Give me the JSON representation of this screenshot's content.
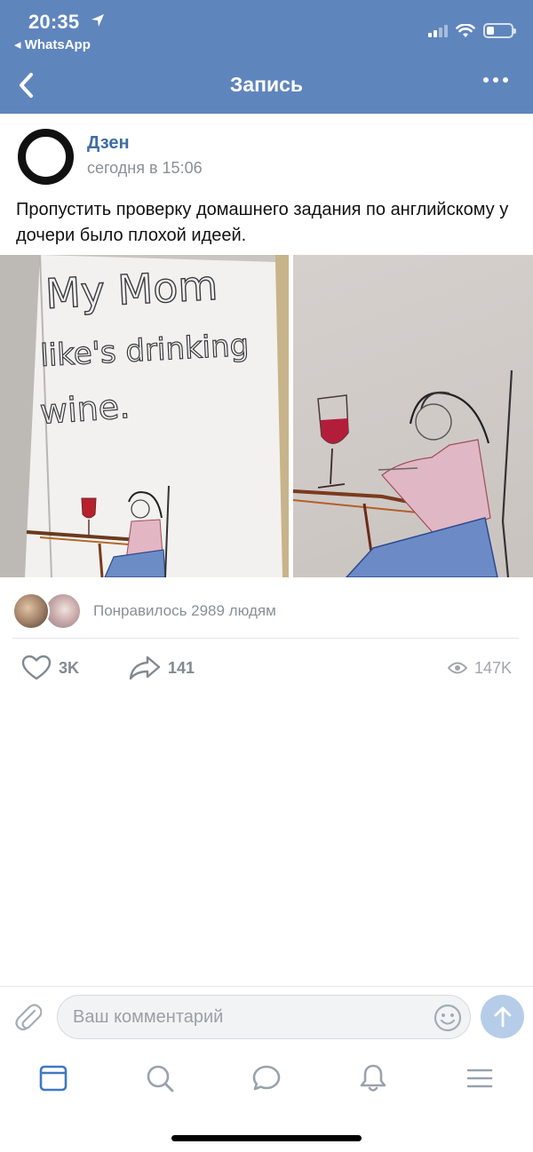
{
  "status_bar": {
    "time": "20:35",
    "back_app": "◂ WhatsApp",
    "location_icon": "location-arrow-icon",
    "signal_icon": "cellular-signal-icon",
    "wifi_icon": "wifi-icon",
    "battery_icon": "battery-icon",
    "battery_level": 0.3
  },
  "nav": {
    "title": "Запись",
    "back_icon": "chevron-left-icon",
    "more_icon": "more-dots-icon"
  },
  "post": {
    "author": "Дзен",
    "time": "сегодня в 15:06",
    "text": "Пропустить проверку домашнего задания по английскому у дочери было плохой идеей.",
    "photo_left_caption": [
      "My Mom",
      "like's drinking",
      "wine."
    ]
  },
  "likes": {
    "text": "Понравилось 2989 людям"
  },
  "actions": {
    "likes_count": "3K",
    "shares_count": "141",
    "views_count": "147K",
    "like_icon": "heart-icon",
    "share_icon": "share-arrow-icon",
    "views_icon": "eye-icon"
  },
  "comment": {
    "placeholder": "Ваш комментарий",
    "attach_icon": "paperclip-icon",
    "emoji_icon": "smile-icon",
    "send_icon": "send-arrow-icon"
  },
  "tabs": [
    {
      "name": "news",
      "icon": "feed-icon",
      "active": true
    },
    {
      "name": "search",
      "icon": "search-icon",
      "active": false
    },
    {
      "name": "messages",
      "icon": "chat-icon",
      "active": false
    },
    {
      "name": "notifications",
      "icon": "bell-icon",
      "active": false
    },
    {
      "name": "menu",
      "icon": "menu-icon",
      "active": false
    }
  ],
  "colors": {
    "header": "#5f85bd",
    "accent": "#3e6ea3",
    "active_tab": "#3f78c1",
    "inactive_tab": "#99a2ad"
  }
}
